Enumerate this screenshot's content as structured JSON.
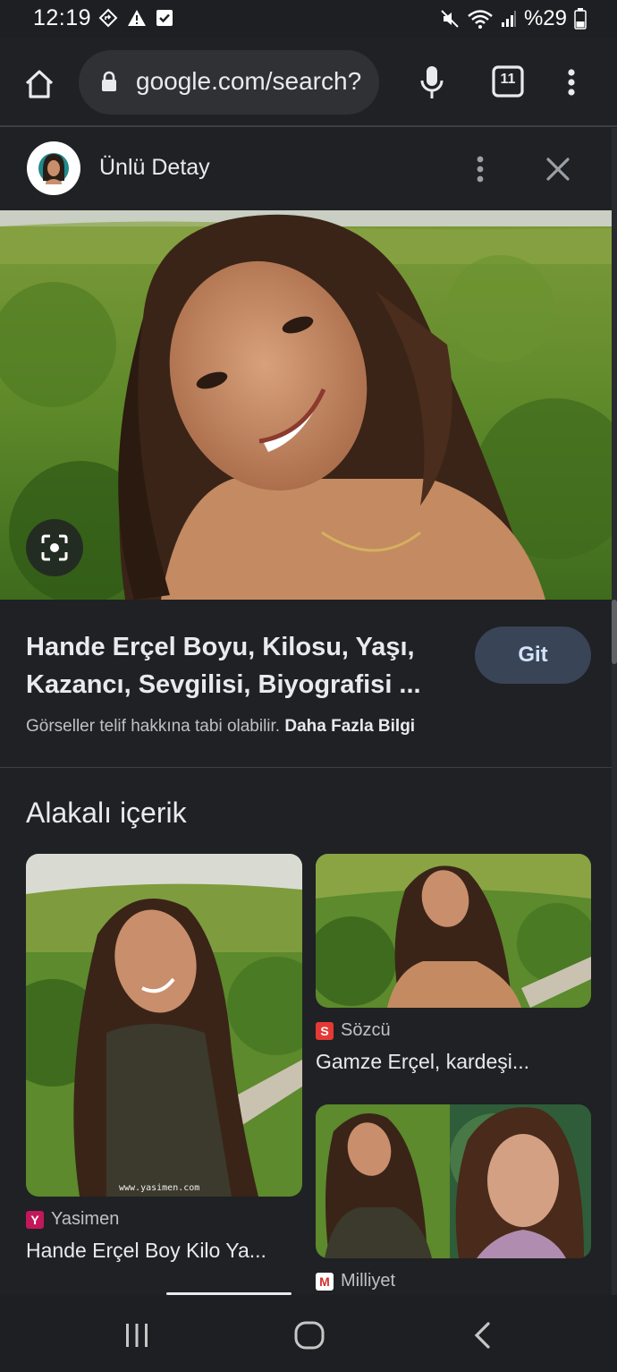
{
  "status_bar": {
    "time": "12:19",
    "battery": "%29"
  },
  "browser": {
    "url": "google.com/search?",
    "tab_count": "11"
  },
  "lens_panel": {
    "site_name": "Ünlü Detay",
    "page_title": "Hande Erçel Boyu, Kilosu, Yaşı, Kazancı, Sevgilisi, Biyografisi ...",
    "go_label": "Git",
    "copyright_text": "Görseller telif hakkına tabi olabilir.",
    "learn_more": "Daha Fazla Bilgi"
  },
  "related": {
    "heading": "Alakalı içerik",
    "items": [
      {
        "source": "Yasimen",
        "favicon_letter": "Y",
        "favicon_color": "#c2185b",
        "title": "Hande Erçel Boy Kilo Ya...",
        "watermark": "www.yasimen.com"
      },
      {
        "source": "Sözcü",
        "favicon_letter": "S",
        "favicon_color": "#e53935",
        "title": "Gamze Erçel, kardeşi..."
      },
      {
        "source": "Milliyet",
        "favicon_letter": "M",
        "favicon_color": "#ffffff",
        "title": ""
      }
    ]
  },
  "icons": {
    "home": "home-icon",
    "lock": "lock-icon",
    "mic": "microphone-icon",
    "tabs": "tab-switcher-icon",
    "menu": "more-vert-icon",
    "close": "close-icon",
    "lens": "lens-icon"
  }
}
